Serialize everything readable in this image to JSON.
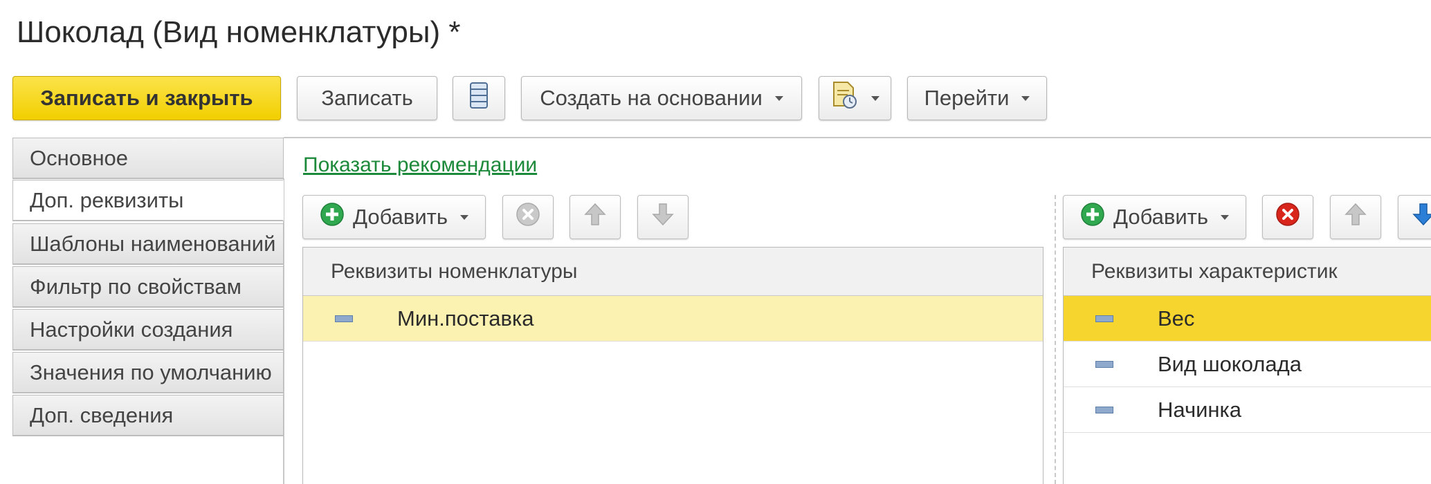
{
  "window": {
    "title": "Шоколад (Вид номенклатуры) *"
  },
  "toolbar": {
    "save_close_label": "Записать и закрыть",
    "save_label": "Записать",
    "create_basis_label": "Создать на основании",
    "go_label": "Перейти"
  },
  "tabs": [
    {
      "label": "Основное"
    },
    {
      "label": "Доп. реквизиты"
    },
    {
      "label": "Шаблоны наименований"
    },
    {
      "label": "Фильтр по свойствам"
    },
    {
      "label": "Настройки создания"
    },
    {
      "label": "Значения по умолчанию"
    },
    {
      "label": "Доп. сведения"
    }
  ],
  "active_tab": "Доп. реквизиты",
  "recommendations_link": "Показать рекомендации",
  "left_panel": {
    "add_label": "Добавить",
    "column_header": "Реквизиты номенклатуры",
    "rows": [
      {
        "label": "Мин.поставка"
      }
    ]
  },
  "right_panel": {
    "add_label": "Добавить",
    "column_header": "Реквизиты характеристик",
    "rows": [
      {
        "label": "Вес"
      },
      {
        "label": "Вид шоколада"
      },
      {
        "label": "Начинка"
      }
    ]
  },
  "colors": {
    "primary_button": "#f2cf00",
    "link": "#1c8a3a",
    "selected_row_active": "#f6d52e",
    "selected_row_inactive": "#fbf1b0",
    "add_icon": "#2fa84f",
    "delete_icon": "#d9261c",
    "move_down_icon": "#2b7fd6"
  },
  "icons": {
    "list": "list-icon",
    "report": "report-icon",
    "add": "plus-circle-icon",
    "delete": "delete-icon",
    "up": "arrow-up-icon",
    "down": "arrow-down-icon",
    "row_marker": "attribute-icon"
  }
}
